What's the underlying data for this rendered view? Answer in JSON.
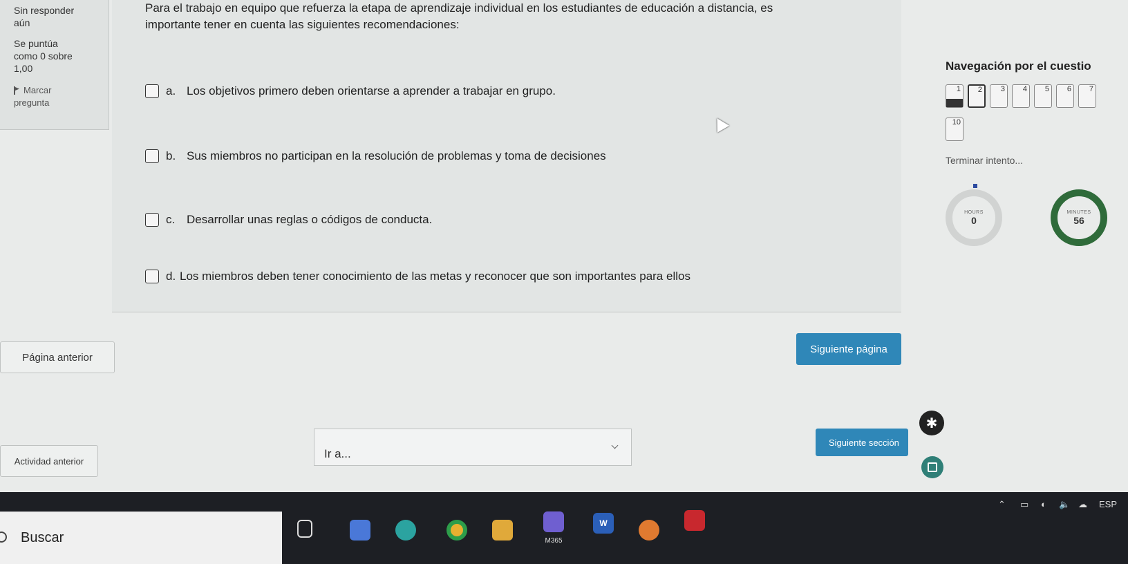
{
  "question_info": {
    "state_line1": "Sin responder",
    "state_line2": "aún",
    "grade_line1": "Se puntúa",
    "grade_line2": "como 0 sobre",
    "grade_line3": "1,00",
    "flag_label": "Marcar",
    "flag_label2": "pregunta"
  },
  "question": {
    "text_line1": "Para el trabajo en equipo que refuerza la etapa de aprendizaje individual en los estudiantes de educación a distancia, es",
    "text_line2": "importante tener en cuenta las siguientes recomendaciones:",
    "options": [
      {
        "letter": "a.",
        "text": "Los objetivos primero deben orientarse a aprender a trabajar en grupo."
      },
      {
        "letter": "b.",
        "text": "Sus miembros no participan en la resolución de problemas y toma de decisiones"
      },
      {
        "letter": "c.",
        "text": "Desarrollar unas reglas o códigos de conducta."
      },
      {
        "letter": "d.",
        "text": "Los miembros deben tener conocimiento de las metas y reconocer que son importantes para ellos"
      }
    ]
  },
  "navigation": {
    "title": "Navegación por el cuestio",
    "buttons": [
      "1",
      "2",
      "3",
      "4",
      "5",
      "6",
      "7",
      "10"
    ],
    "finish_label": "Terminar intento...",
    "timer": {
      "hours_label": "HOURS",
      "hours_value": "0",
      "minutes_label": "MINUTES",
      "minutes_value": "56"
    }
  },
  "buttons": {
    "prev_page": "Página anterior",
    "next_page": "Siguiente página",
    "prev_activity": "Actividad anterior",
    "next_section": "Siguiente sección",
    "jump_select": "Ir a..."
  },
  "taskbar": {
    "search_label": "Buscar",
    "m365_label": "M365",
    "word_label": "W",
    "language": "ESP"
  },
  "colors": {
    "primary_button": "#2f87b8",
    "timer_minutes": "#2f6b3a",
    "taskbar": "#1d1f24"
  }
}
